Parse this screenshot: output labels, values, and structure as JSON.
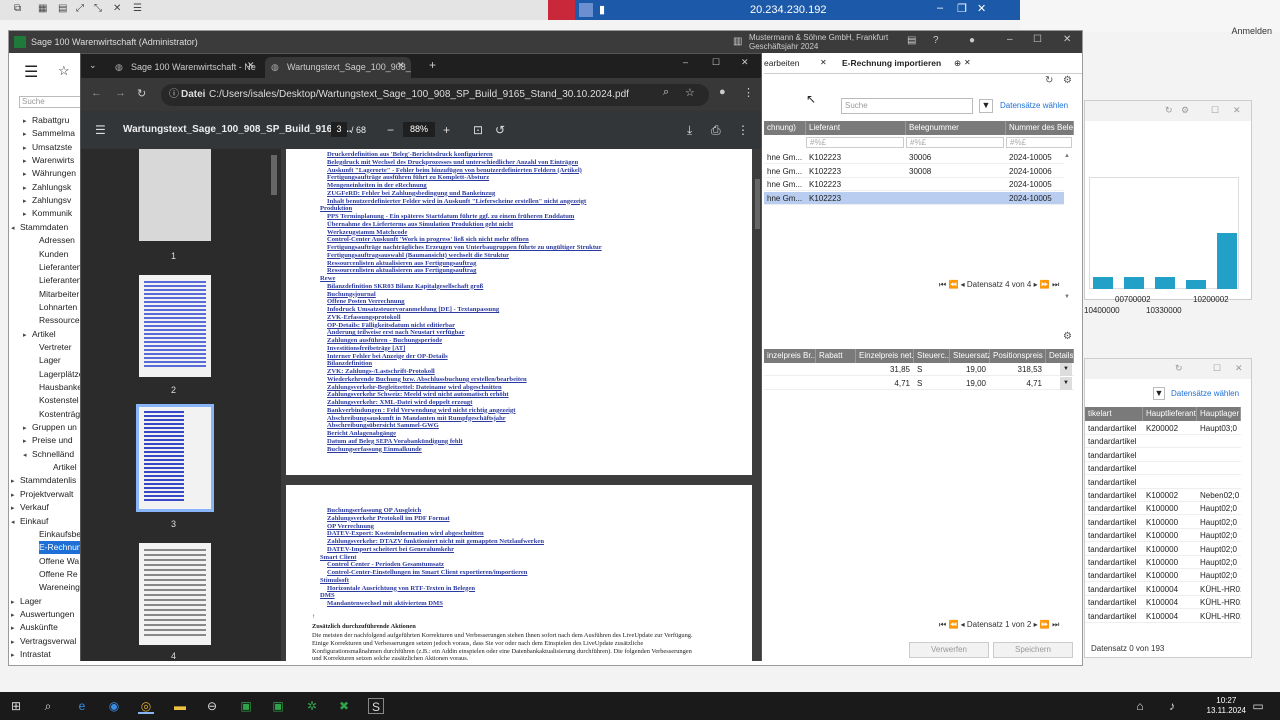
{
  "remote_desktop": {
    "host": "20.234.230.192",
    "login_label": "Anmelden"
  },
  "sage": {
    "title": "Sage 100 Warenwirtschaft (Administrator)",
    "company": "Mustermann & Söhne GmbH, Frankfurt",
    "fiscal_year": "Geschäftsjahr 2024",
    "search_placeholder": "Suche",
    "nav": [
      {
        "label": "Rabattgru",
        "level": 2,
        "expander": "▸"
      },
      {
        "label": "Sammelma",
        "level": 2,
        "expander": "▸"
      },
      {
        "label": "Umsatzste",
        "level": 2,
        "expander": "▸"
      },
      {
        "label": "Warenwirts",
        "level": 2,
        "expander": "▸"
      },
      {
        "label": "Währungen",
        "level": 2,
        "expander": "▸"
      },
      {
        "label": "Zahlungsk",
        "level": 2,
        "expander": "▸"
      },
      {
        "label": "Zahlungsv",
        "level": 2,
        "expander": "▸"
      },
      {
        "label": "Kommunik",
        "level": 2,
        "expander": "▸"
      },
      {
        "label": "Stammdaten",
        "level": 1,
        "expander": "◂"
      },
      {
        "label": "Adressen",
        "level": 3,
        "expander": ""
      },
      {
        "label": "Kunden",
        "level": 3,
        "expander": ""
      },
      {
        "label": "Lieferanten",
        "level": 3,
        "expander": ""
      },
      {
        "label": "Lieferanten",
        "level": 3,
        "expander": ""
      },
      {
        "label": "Mitarbeiter",
        "level": 3,
        "expander": ""
      },
      {
        "label": "Lohnarten",
        "level": 3,
        "expander": ""
      },
      {
        "label": "Ressourcen",
        "level": 3,
        "expander": ""
      },
      {
        "label": "Artikel",
        "level": 2,
        "expander": "▸"
      },
      {
        "label": "Vertreter",
        "level": 3,
        "expander": ""
      },
      {
        "label": "Lager",
        "level": 3,
        "expander": ""
      },
      {
        "label": "Lagerplätze",
        "level": 3,
        "expander": ""
      },
      {
        "label": "Hausbanken",
        "level": 3,
        "expander": ""
      },
      {
        "label": "Kostenstel",
        "level": 3,
        "expander": ""
      },
      {
        "label": "Kostenträg",
        "level": 3,
        "expander": ""
      },
      {
        "label": "Gruppen un",
        "level": 2,
        "expander": "▸"
      },
      {
        "label": "Preise und",
        "level": 2,
        "expander": "▸"
      },
      {
        "label": "Schnelländ",
        "level": 2,
        "expander": "◂"
      },
      {
        "label": "Artikel",
        "level": 4,
        "expander": ""
      },
      {
        "label": "Stammdatenlis",
        "level": 1,
        "expander": "▸"
      },
      {
        "label": "Projektverwalt",
        "level": 1,
        "expander": "▸"
      },
      {
        "label": "Verkauf",
        "level": 1,
        "expander": "▸"
      },
      {
        "label": "Einkauf",
        "level": 1,
        "expander": "◂"
      },
      {
        "label": "Einkaufsbe",
        "level": 3,
        "expander": ""
      },
      {
        "label": "E-Rechnun",
        "level": 3,
        "expander": "",
        "selected": true
      },
      {
        "label": "Offene Wa",
        "level": 3,
        "expander": ""
      },
      {
        "label": "Offene Re",
        "level": 3,
        "expander": ""
      },
      {
        "label": "Wareneing",
        "level": 3,
        "expander": ""
      },
      {
        "label": "Lager",
        "level": 1,
        "expander": "▸"
      },
      {
        "label": "Auswertungen",
        "level": 1,
        "expander": "▸"
      },
      {
        "label": "Auskünfte",
        "level": 1,
        "expander": "▸"
      },
      {
        "label": "Vertragsverwal",
        "level": 1,
        "expander": "▸"
      },
      {
        "label": "Intrastat",
        "level": 1,
        "expander": "▸"
      }
    ],
    "doc_tabs": [
      {
        "label": "earbeiten"
      },
      {
        "label": "E-Rechnung importieren",
        "active": true
      }
    ],
    "grid1": {
      "search_placeholder": "Suche",
      "datasets_label": "Datensätze wählen",
      "columns": [
        "chnung)",
        "Lieferant",
        "Belegnummer",
        "Nummer des Beleg"
      ],
      "filter_hint": "#%£",
      "rows": [
        [
          "hne Gm...",
          "K102223",
          "30006",
          "2024-10005"
        ],
        [
          "hne Gm...",
          "K102223",
          "30008",
          "2024-10006"
        ],
        [
          "hne Gm...",
          "K102223",
          "",
          "2024-10005"
        ],
        [
          "hne Gm...",
          "K102223",
          "",
          "2024-10005"
        ]
      ],
      "pager": "Datensatz 4 von 4"
    },
    "grid2": {
      "columns": [
        "inzelpreis Br...",
        "Rabatt",
        "Einzelpreis net...",
        "Steuerc...",
        "Steuersatz",
        "Positionspreis",
        "Details"
      ],
      "rows": [
        [
          "",
          "",
          "31,85",
          "S",
          "19,00",
          "318,53"
        ],
        [
          "",
          "",
          "4,71",
          "S",
          "19,00",
          "4,71"
        ]
      ],
      "pager": "Datensatz 1 von 2"
    },
    "buttons": {
      "discard": "Verwerfen",
      "save": "Speichern"
    },
    "bg_chart": {
      "labels": [
        "00700002",
        "10200002",
        "10400000",
        "10330000"
      ]
    },
    "bg_grid": {
      "datasets_label": "Datensätze wählen",
      "columns": [
        "tikelart",
        "Hauptlieferant",
        "Hauptlager"
      ],
      "rows": [
        [
          "tandardartikel",
          "K200002",
          "Haupt03;0"
        ],
        [
          "tandardartikel",
          "",
          ""
        ],
        [
          "tandardartikel",
          "",
          ""
        ],
        [
          "tandardartikel",
          "",
          ""
        ],
        [
          "tandardartikel",
          "",
          ""
        ],
        [
          "tandardartikel",
          "K100002",
          "Neben02;0"
        ],
        [
          "tandardartikel",
          "K100000",
          "Haupt02;0"
        ],
        [
          "tandardartikel",
          "K100000",
          "Haupt02;0"
        ],
        [
          "tandardartikel",
          "K100000",
          "Haupt02;0"
        ],
        [
          "tandardartikel",
          "K100000",
          "Haupt02;0"
        ],
        [
          "tandardartikel",
          "K100000",
          "Haupt02;0"
        ],
        [
          "tandardartikel",
          "K100000",
          "Haupt02;0"
        ],
        [
          "tandardartikel",
          "K100004",
          "KÜHL-HR01"
        ],
        [
          "tandardartikel",
          "K100004",
          "KÜHL-HR01"
        ],
        [
          "tandardartikel",
          "K100004",
          "KÜHL-HR01"
        ]
      ],
      "pager": "Datensatz 0 von 193"
    }
  },
  "browser": {
    "tabs": [
      {
        "label": "Sage 100 Warenwirtschaft - Ne"
      },
      {
        "label": "Wartungstext_Sage_100_908_S",
        "active": true
      }
    ],
    "url_scheme": "Datei",
    "url": "C:/Users/isales/Desktop/Wartungstext_Sage_100_908_SP_Build_9165_Stand_30.10.2024.pdf",
    "pdf": {
      "title": "Wartungstext_Sage_100_908_SP_Build_9165_...",
      "page": "3",
      "total": "/ 68",
      "zoom": "88%",
      "thumb_numbers": [
        "1",
        "2",
        "3",
        "4"
      ],
      "page_a_lines": [
        {
          "t": "Druckerdefinition aus 'Beleg'-Berichtsdruck konfigurieren",
          "h": false
        },
        {
          "t": "Belegdruck mit Wechsel des Druckprozesses und unterschiedlicher Anzahl von Einträgen",
          "h": false
        },
        {
          "t": "Auskunft \"Lagerorte\" - Fehler beim hinzufügen von benutzerdefinierten Feldern (Artikel)",
          "h": false
        },
        {
          "t": "Fertigungsaufträge ausführen führt zu Komplett-Absturz",
          "h": false
        },
        {
          "t": "Mengeneinheiten in der eRechnung",
          "h": false
        },
        {
          "t": "ZUGFeRD: Fehler bei Zahlungsbedingung und Bankeinzug",
          "h": false
        },
        {
          "t": "Inhalt benutzerdefinierter Felder wird in Auskunft \"Lieferscheine erstellen\" nicht angezeigt",
          "h": false
        },
        {
          "t": "Produktion",
          "h": true
        },
        {
          "t": "PPS Terminplanung - Ein späteres Startdatum führte ggf. zu einem früheren Enddatum",
          "h": false
        },
        {
          "t": "Übernahme des Lieferterms aus Simulation Produktion geht nicht",
          "h": false
        },
        {
          "t": "Werkzeugstamm Matchcode",
          "h": false
        },
        {
          "t": "Control-Center Auskunft 'Work in progress' ließ sich nicht mehr öffnen",
          "h": false
        },
        {
          "t": "Fertigungsaufträge nachträgliches Erzeugen von Unterbaugruppen führte zu ungültiger Struktur",
          "h": false
        },
        {
          "t": "Fertigungsauftragsauswahl (Baumansicht) wechselt die Struktur",
          "h": false
        },
        {
          "t": "Ressourcenlisten aktualisieren aus Fertigungsauftrag",
          "h": false
        },
        {
          "t": "Ressourcenlisten aktualisieren aus Fertigungsauftrag",
          "h": false
        },
        {
          "t": "Rewe",
          "h": true
        },
        {
          "t": "Bilanzdefinition SKR03 Bilanz Kapitalgesellschaft groß",
          "h": false
        },
        {
          "t": "Buchungsjournal",
          "h": false
        },
        {
          "t": "Offene Posten Verrechnung",
          "h": false
        },
        {
          "t": "Infodruck Umsatzsteuervoranmeldung [DE] - Textanpassung",
          "h": false
        },
        {
          "t": "ZVK-Erfassungsprotokoll",
          "h": false
        },
        {
          "t": "OP-Details: Fälligkeitsdatum nicht editierbar",
          "h": false
        },
        {
          "t": "Änderung teilweise erst nach Neustart verfügbar",
          "h": false
        },
        {
          "t": "Zahlungen ausführen - Buchungsperiode",
          "h": false
        },
        {
          "t": "Investitionsfreibeträge [AT]",
          "h": false
        },
        {
          "t": "Interner Fehler bei Anzeige der OP-Details",
          "h": false
        },
        {
          "t": "Bilanzdefinition",
          "h": false
        },
        {
          "t": "ZVK: Zahlungs-/Lastschrift-Protokoll",
          "h": false
        },
        {
          "t": "Wiederkehrende Buchung bzw. Abschlussbuchung erstellen/bearbeiten",
          "h": false
        },
        {
          "t": "Zahlungsverkehr-Begleitzettel: Dateiname wird abgeschnitten",
          "h": false
        },
        {
          "t": "Zahlungsverkehr Schweiz: Meeld wird nicht automatisch erhöht",
          "h": false
        },
        {
          "t": "Zahlungsverkehr: XML-Datei wird doppelt erzeugt",
          "h": false
        },
        {
          "t": "Bankverbindungen : Feld Verwendung wird nicht richtig angezeigt",
          "h": false
        },
        {
          "t": "Abschreibungsauskunft in Mandanten mit Rumpfgeschäftsjahr",
          "h": false
        },
        {
          "t": "Abschreibungsübersicht Sammel-GWG",
          "h": false
        },
        {
          "t": "Bericht Anlagenabgänge",
          "h": false
        },
        {
          "t": "Datum auf Beleg SEPA Vorabankündigung fehlt",
          "h": false
        },
        {
          "t": "Buchungserfassung Einmalkunde",
          "h": false
        }
      ],
      "page_b_lines": [
        {
          "t": "Buchungserfassung OP Ausgleich",
          "h": false
        },
        {
          "t": "Zahlungsverkehr Protokoll im PDF Format",
          "h": false
        },
        {
          "t": "OP Verrechnung",
          "h": false
        },
        {
          "t": "DATEV-Export: Kosteninformation wird abgeschnitten",
          "h": false
        },
        {
          "t": "Zahlungsverkehr: DTAZV funktioniert nicht mit gemappten Netzlaufwerken",
          "h": false
        },
        {
          "t": "DATEV-Import scheitert bei Generalumkehr",
          "h": false
        },
        {
          "t": "Smart Client",
          "h": true
        },
        {
          "t": "Control Center - Perioden Gesamtumsatz",
          "h": false
        },
        {
          "t": "Control-Center-Einstellungen im Smart Client exportieren/importieren",
          "h": false
        },
        {
          "t": "Stimulsoft",
          "h": true
        },
        {
          "t": "Horizontale Ausrichtung von RTF-Texten in Belegen",
          "h": false
        },
        {
          "t": "DMS",
          "h": true
        },
        {
          "t": "Mandantenwechsel mit aktiviertem DMS",
          "h": false
        }
      ],
      "page_b_arrow": "↑",
      "page_b_heading": "Zusätzlich durchzuführende Aktionen",
      "page_b_text": [
        "Die meisten der nachfolgend aufgeführten Korrekturen und Verbesserungen stehen Ihnen sofort nach dem Ausführen des LiveUpdate zur Verfügung.",
        "Einige Korrekturen und Verbesserungen setzen jedoch voraus, dass Sie vor oder nach dem Einspielen des LiveUpdate zusätzliche",
        "Konfigurationsmaßnahmen durchführen (z.B.: ein Addin einspielen oder eine Datenbankaktualisierung durchführen). Die folgenden Verbesserungen",
        "und Korrekturen setzen solche zusätzlichen Aktionen voraus."
      ]
    }
  },
  "taskbar": {
    "time": "10:27",
    "date": "13.11.2024"
  }
}
